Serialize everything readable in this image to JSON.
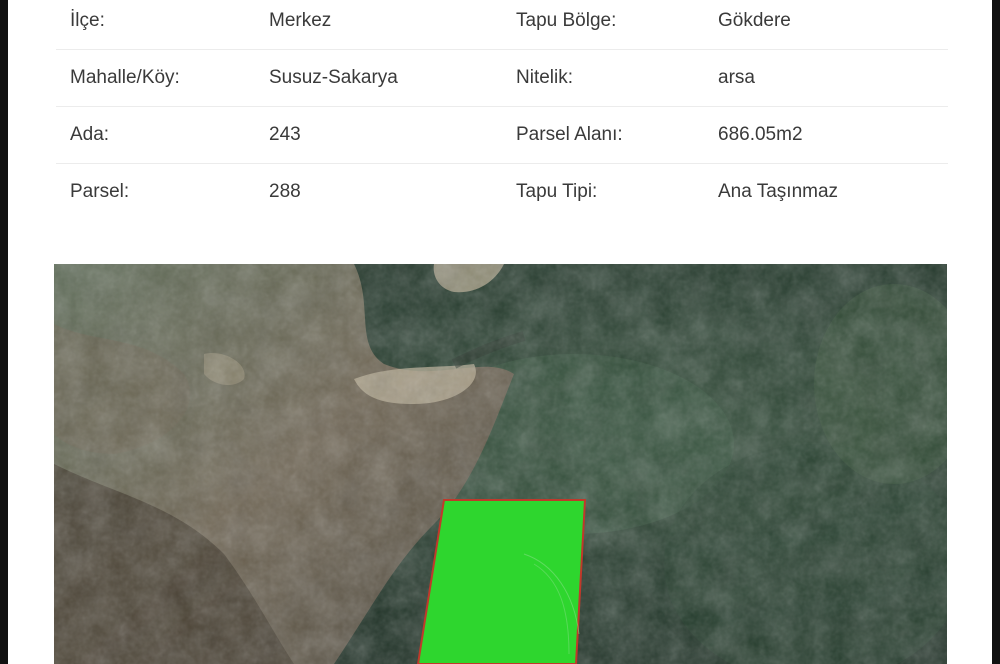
{
  "details": {
    "rows": [
      {
        "label1": "İlçe:",
        "value1": "Merkez",
        "label2": "Tapu Bölge:",
        "value2": "Gökdere"
      },
      {
        "label1": "Mahalle/Köy:",
        "value1": "Susuz-Sakarya",
        "label2": "Nitelik:",
        "value2": "arsa"
      },
      {
        "label1": "Ada:",
        "value1": "243",
        "label2": "Parsel Alanı:",
        "value2": "686.05m2"
      },
      {
        "label1": "Parsel:",
        "value1": "288",
        "label2": "Tapu Tipi:",
        "value2": "Ana Taşınmaz"
      }
    ]
  },
  "map": {
    "parcel_color": "#2ed62e",
    "parcel_border_color": "#c0392b"
  }
}
